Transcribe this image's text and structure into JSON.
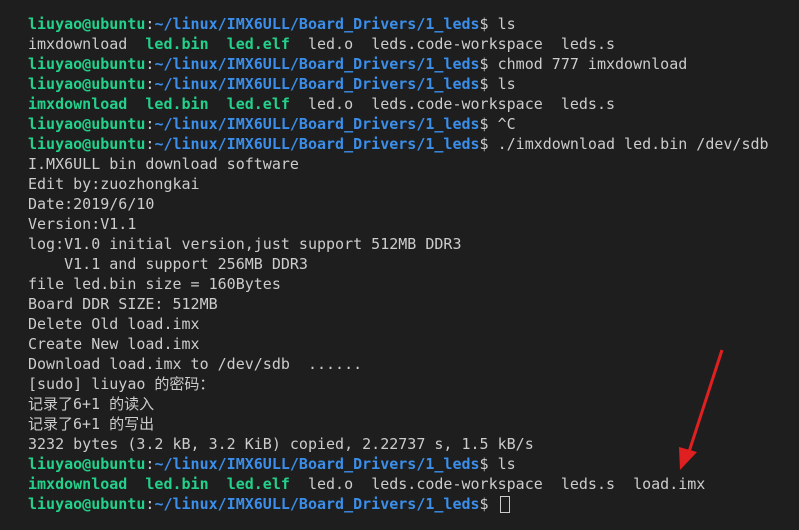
{
  "prompt": {
    "user": "liuyao@ubuntu",
    "colon": ":",
    "path": "~/linux/IMX6ULL/Board_Drivers/1_leds",
    "dollar": "$ "
  },
  "colors": {
    "background": "#1e1e1e",
    "user": "#23d18b",
    "path": "#3b8eea",
    "text": "#cccccc",
    "arrow": "#e02020"
  },
  "lines": [
    {
      "cmd": "ls"
    },
    {
      "files": [
        "imxdownload",
        "led.bin",
        "led.elf",
        "led.o",
        "leds.code-workspace",
        "leds.s"
      ]
    },
    {
      "cmd": "chmod 777 imxdownload"
    },
    {
      "cmd": "ls"
    },
    {
      "files": [
        "imxdownload",
        "led.bin",
        "led.elf",
        "led.o",
        "leds.code-workspace",
        "leds.s"
      ]
    },
    {
      "cmd": "^C"
    },
    {
      "cmd": "./imxdownload led.bin /dev/sdb"
    },
    {
      "text": "I.MX6ULL bin download software"
    },
    {
      "text": "Edit by:zuozhongkai"
    },
    {
      "text": "Date:2019/6/10"
    },
    {
      "text": "Version:V1.1"
    },
    {
      "text": "log:V1.0 initial version,just support 512MB DDR3"
    },
    {
      "text": "    V1.1 and support 256MB DDR3"
    },
    {
      "text": "file led.bin size = 160Bytes"
    },
    {
      "text": "Board DDR SIZE: 512MB"
    },
    {
      "text": "Delete Old load.imx"
    },
    {
      "text": "Create New load.imx"
    },
    {
      "text": "Download load.imx to /dev/sdb  ......"
    },
    {
      "text": "[sudo] liuyao 的密码："
    },
    {
      "text": "记录了6+1 的读入"
    },
    {
      "text": "记录了6+1 的写出"
    },
    {
      "text": "3232 bytes (3.2 kB, 3.2 KiB) copied, 2.22737 s, 1.5 kB/s"
    },
    {
      "cmd": "ls"
    },
    {
      "files": [
        "imxdownload",
        "led.bin",
        "led.elf",
        "led.o",
        "leds.code-workspace",
        "leds.s",
        "load.imx"
      ]
    },
    {
      "cmd": ""
    }
  ],
  "executables": [
    "imxdownload",
    "led.bin",
    "led.elf"
  ],
  "first_listing_plain_imxdownload": true
}
